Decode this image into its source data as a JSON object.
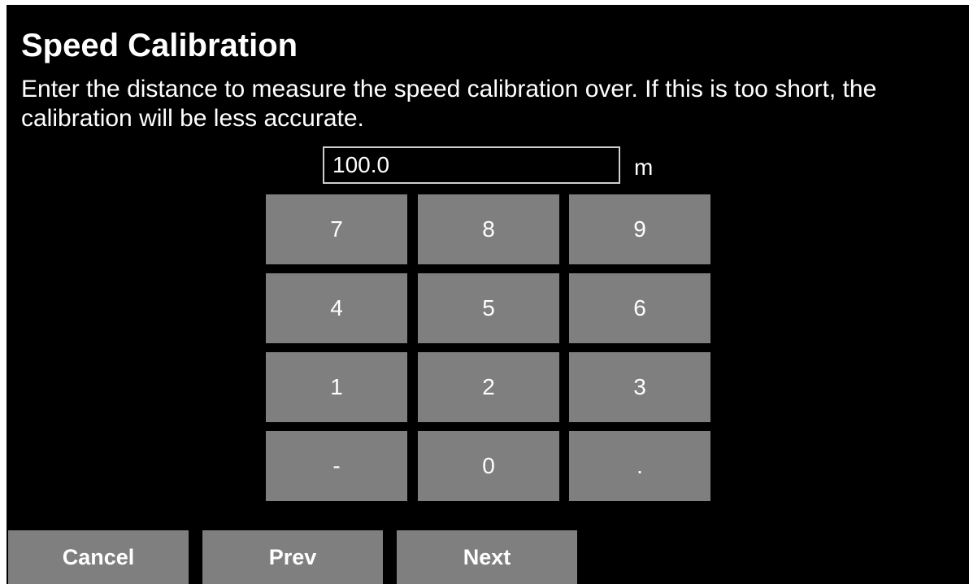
{
  "screen": {
    "title": "Speed Calibration",
    "instructions": "Enter the distance to measure the speed calibration over. If this is too short, the calibration will be less accurate."
  },
  "distance": {
    "value": "100.0",
    "unit": "m"
  },
  "keypad": {
    "k7": "7",
    "k8": "8",
    "k9": "9",
    "k4": "4",
    "k5": "5",
    "k6": "6",
    "k1": "1",
    "k2": "2",
    "k3": "3",
    "minus": "-",
    "k0": "0",
    "dot": "."
  },
  "nav": {
    "cancel": "Cancel",
    "prev": "Prev",
    "next": "Next"
  },
  "colors": {
    "background": "#000000",
    "button": "#7f7f7f",
    "text": "#ffffff",
    "field_border": "#cfcfcf"
  }
}
